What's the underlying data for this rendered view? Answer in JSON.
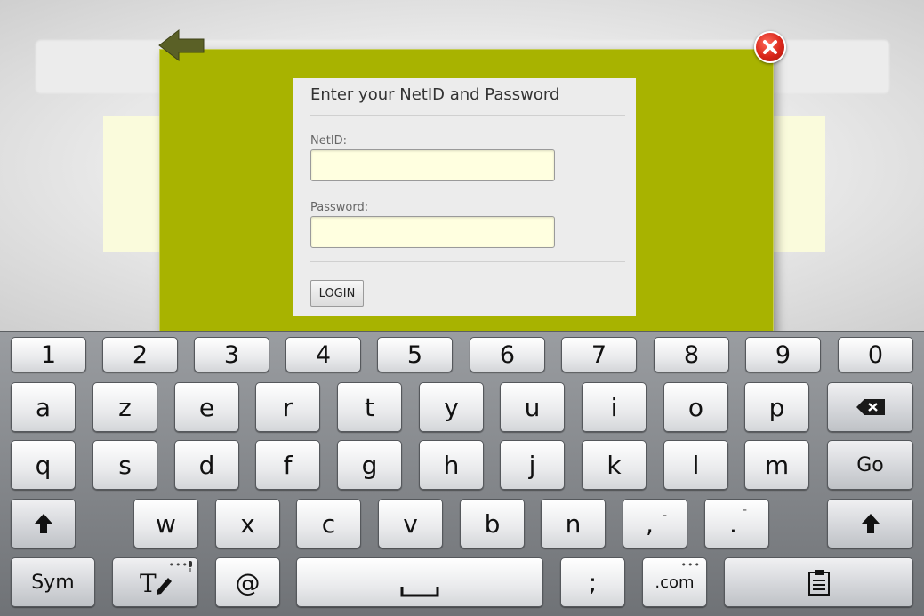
{
  "dialog": {
    "title": "Enter your NetID and Password",
    "netid_label": "NetID:",
    "netid_value": "",
    "password_label": "Password:",
    "password_value": "",
    "login_label": "LOGIN"
  },
  "keyboard": {
    "number_row": [
      "1",
      "2",
      "3",
      "4",
      "5",
      "6",
      "7",
      "8",
      "9",
      "0"
    ],
    "row1": [
      "a",
      "z",
      "e",
      "r",
      "t",
      "y",
      "u",
      "i",
      "o",
      "p"
    ],
    "row2": [
      "q",
      "s",
      "d",
      "f",
      "g",
      "h",
      "j",
      "k",
      "l",
      "m"
    ],
    "go_label": "Go",
    "row3": [
      "w",
      "x",
      "c",
      "v",
      "b",
      "n"
    ],
    "comma_key": ",",
    "comma_sub": "-",
    "period_key": ".",
    "period_sub": "-",
    "sym_label": "Sym",
    "at_label": "@",
    "semicolon_label": ";",
    "dotcom_label": ".com",
    "more_dots": "•••"
  },
  "colors": {
    "dialog_bg": "#a8b300",
    "input_bg": "#ffffe0",
    "close_red": "#d9261a"
  }
}
